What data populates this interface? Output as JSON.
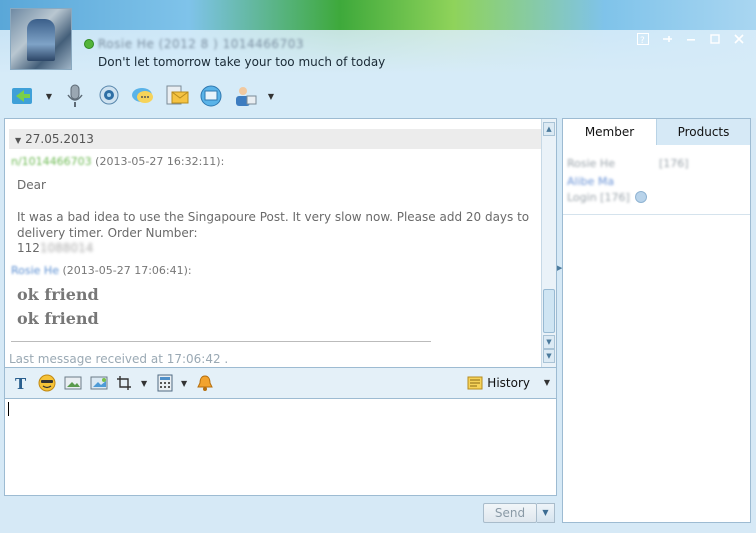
{
  "header": {
    "contact_name": "Rosie He (2012 8 ) 1014466703",
    "status_message": "Don't let tomorrow take your too much of today"
  },
  "window_controls": [
    "help-icon",
    "pin-icon",
    "minimize-icon",
    "maximize-icon",
    "close-icon"
  ],
  "toolbar": {
    "icons": [
      "transfer-icon",
      "microphone-icon",
      "webcam-icon",
      "chat-bubble-icon",
      "email-icon",
      "screen-share-icon",
      "contacts-icon"
    ]
  },
  "chat": {
    "date_header": "27.05.2013",
    "messages": [
      {
        "sender": "n/1014466703",
        "timestamp": "(2013-05-27 16:32:11):",
        "lines": [
          "Dear",
          "",
          "It was a bad idea to use the Singapoure Post. It very slow now. Please add 20 days to",
          "delivery timer. Order Number:"
        ],
        "order_prefix": "112",
        "order_rest": "1088014"
      },
      {
        "sender": "Rosie He",
        "timestamp": "(2013-05-27 17:06:41):",
        "lines": [
          "ok friend",
          "ok friend"
        ]
      }
    ],
    "last_message": "Last message received at 17:06:42 ."
  },
  "format_toolbar": {
    "history_label": "History"
  },
  "send": {
    "label": "Send"
  },
  "right_panel": {
    "tabs": [
      "Member",
      "Products"
    ],
    "member": {
      "name": "Rosie He",
      "rating": "[176]",
      "link": "Alibe Ma",
      "login": "Login [176]"
    }
  },
  "colors": {
    "online": "#53b43a",
    "accent": "#9dbbd2",
    "sender_green": "#6fbb55",
    "sender_blue": "#5b8fd2"
  }
}
